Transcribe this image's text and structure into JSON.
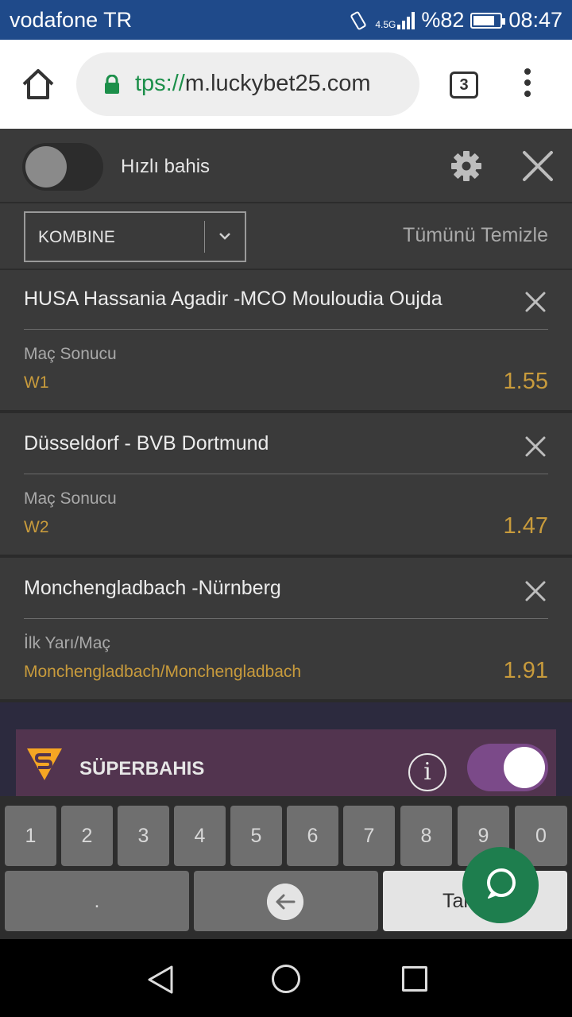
{
  "status_bar": {
    "carrier": "vodafone TR",
    "network": "4.5G",
    "battery_text": "%82",
    "battery_level": 0.82,
    "time": "08:47"
  },
  "browser": {
    "url_scheme": "tps://",
    "url_host": "m.luckybet25.com",
    "tab_count": "3"
  },
  "header": {
    "quick_bet_label": "Hızlı bahis",
    "quick_bet_on": false
  },
  "filter": {
    "bet_type": "KOMBINE",
    "clear_all_label": "Tümünü Temizle"
  },
  "bets": [
    {
      "match": "HUSA Hassania Agadir -MCO Mouloudia Oujda",
      "market": "Maç Sonucu",
      "selection": "W1",
      "odd": "1.55"
    },
    {
      "match": "Düsseldorf - BVB Dortmund",
      "market": "Maç Sonucu",
      "selection": "W2",
      "odd": "1.47"
    },
    {
      "match": "Monchengladbach -Nürnberg",
      "market": "İlk Yarı/Maç",
      "selection": "Monchengladbach/Monchengladbach",
      "odd": "1.91"
    }
  ],
  "super": {
    "label": "SÜPERBAHIS",
    "info": "i",
    "enabled": true
  },
  "keyboard": {
    "digits": [
      "1",
      "2",
      "3",
      "4",
      "5",
      "6",
      "7",
      "8",
      "9",
      "0"
    ],
    "dot": ".",
    "enter_label": "Tamam"
  },
  "colors": {
    "accent_gold": "#c89b3c",
    "super_purple": "#52344f",
    "whatsapp_green": "#1e7e4e"
  }
}
